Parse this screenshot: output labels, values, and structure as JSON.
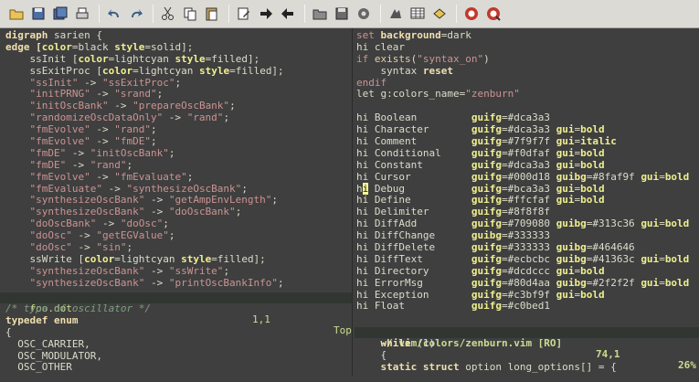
{
  "toolbar": {
    "buttons": [
      {
        "icon": "open-folder-icon"
      },
      {
        "icon": "save-icon"
      },
      {
        "icon": "save-all-icon"
      },
      {
        "icon": "print-icon"
      },
      {
        "icon": "undo-icon"
      },
      {
        "icon": "redo-icon"
      },
      {
        "icon": "cut-icon"
      },
      {
        "icon": "copy-icon"
      },
      {
        "icon": "paste-icon"
      },
      {
        "icon": "replace-icon"
      },
      {
        "icon": "find-next-icon"
      },
      {
        "icon": "find-prev-icon"
      },
      {
        "icon": "load-session-icon"
      },
      {
        "icon": "save-session-icon"
      },
      {
        "icon": "run-script-icon"
      },
      {
        "icon": "make-icon"
      },
      {
        "icon": "shell-icon"
      },
      {
        "icon": "ctags-icon"
      },
      {
        "icon": "help-icon"
      },
      {
        "icon": "find-help-icon"
      }
    ]
  },
  "left_top": {
    "lines": [
      [
        {
          "t": "digraph ",
          "c": "kw"
        },
        {
          "t": "sarien {",
          "c": "ident"
        }
      ],
      [
        {
          "t": "edge [",
          "c": "kw"
        },
        {
          "t": "color",
          "c": "attr"
        },
        {
          "t": "=black ",
          "c": "ident"
        },
        {
          "t": "style",
          "c": "attr"
        },
        {
          "t": "=solid];",
          "c": "ident"
        }
      ],
      [
        {
          "t": "    ssInit [",
          "c": "ident"
        },
        {
          "t": "color",
          "c": "attr"
        },
        {
          "t": "=lightcyan ",
          "c": "ident"
        },
        {
          "t": "style",
          "c": "attr"
        },
        {
          "t": "=filled];",
          "c": "ident"
        }
      ],
      [
        {
          "t": "    ssExitProc [",
          "c": "ident"
        },
        {
          "t": "color",
          "c": "attr"
        },
        {
          "t": "=lightcyan ",
          "c": "ident"
        },
        {
          "t": "style",
          "c": "attr"
        },
        {
          "t": "=filled];",
          "c": "ident"
        }
      ],
      [
        {
          "t": "    \"ssInit\"",
          "c": "str"
        },
        {
          "t": " -> ",
          "c": "ident"
        },
        {
          "t": "\"ssExitProc\"",
          "c": "str"
        },
        {
          "t": ";",
          "c": "ident"
        }
      ],
      [
        {
          "t": "    \"initPRNG\"",
          "c": "str"
        },
        {
          "t": " -> ",
          "c": "ident"
        },
        {
          "t": "\"srand\"",
          "c": "str"
        },
        {
          "t": ";",
          "c": "ident"
        }
      ],
      [
        {
          "t": "    \"initOscBank\"",
          "c": "str"
        },
        {
          "t": " -> ",
          "c": "ident"
        },
        {
          "t": "\"prepareOscBank\"",
          "c": "str"
        },
        {
          "t": ";",
          "c": "ident"
        }
      ],
      [
        {
          "t": "    \"randomizeOscDataOnly\"",
          "c": "str"
        },
        {
          "t": " -> ",
          "c": "ident"
        },
        {
          "t": "\"rand\"",
          "c": "str"
        },
        {
          "t": ";",
          "c": "ident"
        }
      ],
      [
        {
          "t": "    \"fmEvolve\"",
          "c": "str"
        },
        {
          "t": " -> ",
          "c": "ident"
        },
        {
          "t": "\"rand\"",
          "c": "str"
        },
        {
          "t": ";",
          "c": "ident"
        }
      ],
      [
        {
          "t": "    \"fmEvolve\"",
          "c": "str"
        },
        {
          "t": " -> ",
          "c": "ident"
        },
        {
          "t": "\"fmDE\"",
          "c": "str"
        },
        {
          "t": ";",
          "c": "ident"
        }
      ],
      [
        {
          "t": "    \"fmDE\"",
          "c": "str"
        },
        {
          "t": " -> ",
          "c": "ident"
        },
        {
          "t": "\"initOscBank\"",
          "c": "str"
        },
        {
          "t": ";",
          "c": "ident"
        }
      ],
      [
        {
          "t": "    \"fmDE\"",
          "c": "str"
        },
        {
          "t": " -> ",
          "c": "ident"
        },
        {
          "t": "\"rand\"",
          "c": "str"
        },
        {
          "t": ";",
          "c": "ident"
        }
      ],
      [
        {
          "t": "    \"fmEvolve\"",
          "c": "str"
        },
        {
          "t": " -> ",
          "c": "ident"
        },
        {
          "t": "\"fmEvaluate\"",
          "c": "str"
        },
        {
          "t": ";",
          "c": "ident"
        }
      ],
      [
        {
          "t": "    \"fmEvaluate\"",
          "c": "str"
        },
        {
          "t": " -> ",
          "c": "ident"
        },
        {
          "t": "\"synthesizeOscBank\"",
          "c": "str"
        },
        {
          "t": ";",
          "c": "ident"
        }
      ],
      [
        {
          "t": "    \"synthesizeOscBank\"",
          "c": "str"
        },
        {
          "t": " -> ",
          "c": "ident"
        },
        {
          "t": "\"getAmpEnvLength\"",
          "c": "str"
        },
        {
          "t": ";",
          "c": "ident"
        }
      ],
      [
        {
          "t": "    \"synthesizeOscBank\"",
          "c": "str"
        },
        {
          "t": " -> ",
          "c": "ident"
        },
        {
          "t": "\"doOscBank\"",
          "c": "str"
        },
        {
          "t": ";",
          "c": "ident"
        }
      ],
      [
        {
          "t": "    \"doOscBank\"",
          "c": "str"
        },
        {
          "t": " -> ",
          "c": "ident"
        },
        {
          "t": "\"doOsc\"",
          "c": "str"
        },
        {
          "t": ";",
          "c": "ident"
        }
      ],
      [
        {
          "t": "    \"doOsc\"",
          "c": "str"
        },
        {
          "t": " -> ",
          "c": "ident"
        },
        {
          "t": "\"getEGValue\"",
          "c": "str"
        },
        {
          "t": ";",
          "c": "ident"
        }
      ],
      [
        {
          "t": "    \"doOsc\"",
          "c": "str"
        },
        {
          "t": " -> ",
          "c": "ident"
        },
        {
          "t": "\"sin\"",
          "c": "str"
        },
        {
          "t": ";",
          "c": "ident"
        }
      ],
      [
        {
          "t": "    ssWrite [",
          "c": "ident"
        },
        {
          "t": "color",
          "c": "attr"
        },
        {
          "t": "=lightcyan ",
          "c": "ident"
        },
        {
          "t": "style",
          "c": "attr"
        },
        {
          "t": "=filled];",
          "c": "ident"
        }
      ],
      [
        {
          "t": "    \"synthesizeOscBank\"",
          "c": "str"
        },
        {
          "t": " -> ",
          "c": "ident"
        },
        {
          "t": "\"ssWrite\"",
          "c": "str"
        },
        {
          "t": ";",
          "c": "ident"
        }
      ],
      [
        {
          "t": "    \"synthesizeOscBank\"",
          "c": "str"
        },
        {
          "t": " -> ",
          "c": "ident"
        },
        {
          "t": "\"printOscBankInfo\"",
          "c": "str"
        },
        {
          "t": ";",
          "c": "ident"
        }
      ]
    ]
  },
  "status_left": {
    "file": "foo.dot",
    "position": "1,1",
    "scroll": "Top"
  },
  "left_bottom": {
    "lines": [
      [
        {
          "t": "/* type of oscillator */",
          "c": "cmt"
        }
      ],
      [
        {
          "t": "typedef enum",
          "c": "kw"
        }
      ],
      [
        {
          "t": "{",
          "c": "ident"
        }
      ],
      [
        {
          "t": "  OSC_CARRIER,",
          "c": "ident"
        }
      ],
      [
        {
          "t": "  OSC_MODULATOR,",
          "c": "ident"
        }
      ],
      [
        {
          "t": "  OSC_OTHER",
          "c": "ident"
        }
      ]
    ]
  },
  "right": {
    "lines": [
      [
        {
          "t": "set ",
          "c": "str"
        },
        {
          "t": "background",
          "c": "kw"
        },
        {
          "t": "=dark",
          "c": "ident"
        }
      ],
      [
        {
          "t": "hi clear",
          "c": "ident"
        }
      ],
      [
        {
          "t": "if ",
          "c": "str"
        },
        {
          "t": "exists",
          "c": "hi"
        },
        {
          "t": "(",
          "c": "ident"
        },
        {
          "t": "\"syntax_on\"",
          "c": "str"
        },
        {
          "t": ")",
          "c": "ident"
        }
      ],
      [
        {
          "t": "    syntax ",
          "c": "ident"
        },
        {
          "t": "reset",
          "c": "kw"
        }
      ],
      [
        {
          "t": "endif",
          "c": "str"
        }
      ],
      [
        {
          "t": "let g:colors_name=",
          "c": "ident"
        },
        {
          "t": "\"zenburn\"",
          "c": "str"
        }
      ],
      [
        {
          "t": "",
          "c": "ident"
        }
      ],
      [
        {
          "t": "hi Boolean         ",
          "c": "ident"
        },
        {
          "t": "guifg",
          "c": "gr"
        },
        {
          "t": "=#dca3a3",
          "c": "ident"
        }
      ],
      [
        {
          "t": "hi Character       ",
          "c": "ident"
        },
        {
          "t": "guifg",
          "c": "gr"
        },
        {
          "t": "=#dca3a3 ",
          "c": "ident"
        },
        {
          "t": "gui",
          "c": "gr"
        },
        {
          "t": "=",
          "c": "ident"
        },
        {
          "t": "bold",
          "c": "gr"
        }
      ],
      [
        {
          "t": "hi Comment         ",
          "c": "ident"
        },
        {
          "t": "guifg",
          "c": "gr"
        },
        {
          "t": "=#7f9f7f ",
          "c": "ident"
        },
        {
          "t": "gui",
          "c": "gr"
        },
        {
          "t": "=",
          "c": "ident"
        },
        {
          "t": "italic",
          "c": "gr"
        }
      ],
      [
        {
          "t": "hi Conditional     ",
          "c": "ident"
        },
        {
          "t": "guifg",
          "c": "gr"
        },
        {
          "t": "=#f0dfaf ",
          "c": "ident"
        },
        {
          "t": "gui",
          "c": "gr"
        },
        {
          "t": "=",
          "c": "ident"
        },
        {
          "t": "bold",
          "c": "gr"
        }
      ],
      [
        {
          "t": "hi Constant        ",
          "c": "ident"
        },
        {
          "t": "guifg",
          "c": "gr"
        },
        {
          "t": "=#dca3a3 ",
          "c": "ident"
        },
        {
          "t": "gui",
          "c": "gr"
        },
        {
          "t": "=",
          "c": "ident"
        },
        {
          "t": "bold",
          "c": "gr"
        }
      ],
      [
        {
          "t": "hi Cursor          ",
          "c": "ident"
        },
        {
          "t": "guifg",
          "c": "gr"
        },
        {
          "t": "=#000d18 ",
          "c": "ident"
        },
        {
          "t": "guibg",
          "c": "gr"
        },
        {
          "t": "=#8faf9f ",
          "c": "ident"
        },
        {
          "t": "gui",
          "c": "gr"
        },
        {
          "t": "=",
          "c": "ident"
        },
        {
          "t": "bold",
          "c": "gr"
        }
      ],
      [
        {
          "t": "h",
          "c": "ident"
        },
        {
          "t": "i",
          "c": "cursor"
        },
        {
          "t": " Debug           ",
          "c": "ident"
        },
        {
          "t": "guifg",
          "c": "gr"
        },
        {
          "t": "=#bca3a3 ",
          "c": "ident"
        },
        {
          "t": "gui",
          "c": "gr"
        },
        {
          "t": "=",
          "c": "ident"
        },
        {
          "t": "bold",
          "c": "gr"
        }
      ],
      [
        {
          "t": "hi Define          ",
          "c": "ident"
        },
        {
          "t": "guifg",
          "c": "gr"
        },
        {
          "t": "=#ffcfaf ",
          "c": "ident"
        },
        {
          "t": "gui",
          "c": "gr"
        },
        {
          "t": "=",
          "c": "ident"
        },
        {
          "t": "bold",
          "c": "gr"
        }
      ],
      [
        {
          "t": "hi Delimiter       ",
          "c": "ident"
        },
        {
          "t": "guifg",
          "c": "gr"
        },
        {
          "t": "=#8f8f8f",
          "c": "ident"
        }
      ],
      [
        {
          "t": "hi DiffAdd         ",
          "c": "ident"
        },
        {
          "t": "guifg",
          "c": "gr"
        },
        {
          "t": "=#709080 ",
          "c": "ident"
        },
        {
          "t": "guibg",
          "c": "gr"
        },
        {
          "t": "=#313c36 ",
          "c": "ident"
        },
        {
          "t": "gui",
          "c": "gr"
        },
        {
          "t": "=",
          "c": "ident"
        },
        {
          "t": "bold",
          "c": "gr"
        }
      ],
      [
        {
          "t": "hi DiffChange      ",
          "c": "ident"
        },
        {
          "t": "guibg",
          "c": "gr"
        },
        {
          "t": "=#333333",
          "c": "ident"
        }
      ],
      [
        {
          "t": "hi DiffDelete      ",
          "c": "ident"
        },
        {
          "t": "guifg",
          "c": "gr"
        },
        {
          "t": "=#333333 ",
          "c": "ident"
        },
        {
          "t": "guibg",
          "c": "gr"
        },
        {
          "t": "=#464646",
          "c": "ident"
        }
      ],
      [
        {
          "t": "hi DiffText        ",
          "c": "ident"
        },
        {
          "t": "guifg",
          "c": "gr"
        },
        {
          "t": "=#ecbcbc ",
          "c": "ident"
        },
        {
          "t": "guibg",
          "c": "gr"
        },
        {
          "t": "=#41363c ",
          "c": "ident"
        },
        {
          "t": "gui",
          "c": "gr"
        },
        {
          "t": "=",
          "c": "ident"
        },
        {
          "t": "bold",
          "c": "gr"
        }
      ],
      [
        {
          "t": "hi Directory       ",
          "c": "ident"
        },
        {
          "t": "guifg",
          "c": "gr"
        },
        {
          "t": "=#dcdccc ",
          "c": "ident"
        },
        {
          "t": "gui",
          "c": "gr"
        },
        {
          "t": "=",
          "c": "ident"
        },
        {
          "t": "bold",
          "c": "gr"
        }
      ],
      [
        {
          "t": "hi ErrorMsg        ",
          "c": "ident"
        },
        {
          "t": "guifg",
          "c": "gr"
        },
        {
          "t": "=#80d4aa ",
          "c": "ident"
        },
        {
          "t": "guibg",
          "c": "gr"
        },
        {
          "t": "=#2f2f2f ",
          "c": "ident"
        },
        {
          "t": "gui",
          "c": "gr"
        },
        {
          "t": "=",
          "c": "ident"
        },
        {
          "t": "bold",
          "c": "gr"
        }
      ],
      [
        {
          "t": "hi Exception       ",
          "c": "ident"
        },
        {
          "t": "guifg",
          "c": "gr"
        },
        {
          "t": "=#c3bf9f ",
          "c": "ident"
        },
        {
          "t": "gui",
          "c": "gr"
        },
        {
          "t": "=",
          "c": "ident"
        },
        {
          "t": "bold",
          "c": "gr"
        }
      ],
      [
        {
          "t": "hi Float           ",
          "c": "ident"
        },
        {
          "t": "guifg",
          "c": "gr"
        },
        {
          "t": "=#c0bed1",
          "c": "ident"
        }
      ]
    ]
  },
  "status_right": {
    "file": "~/.vim/colors/zenburn.vim [RO]",
    "position": "74,1",
    "scroll": "26%"
  },
  "right_bottom": {
    "lines": [
      [
        {
          "t": "    ",
          "c": "ident"
        },
        {
          "t": "while",
          "c": "kw"
        },
        {
          "t": " (1)",
          "c": "ident"
        }
      ],
      [
        {
          "t": "    {",
          "c": "ident"
        }
      ],
      [
        {
          "t": "    ",
          "c": "ident"
        },
        {
          "t": "static struct",
          "c": "kw"
        },
        {
          "t": " option long_options[] = {",
          "c": "ident"
        }
      ]
    ]
  }
}
